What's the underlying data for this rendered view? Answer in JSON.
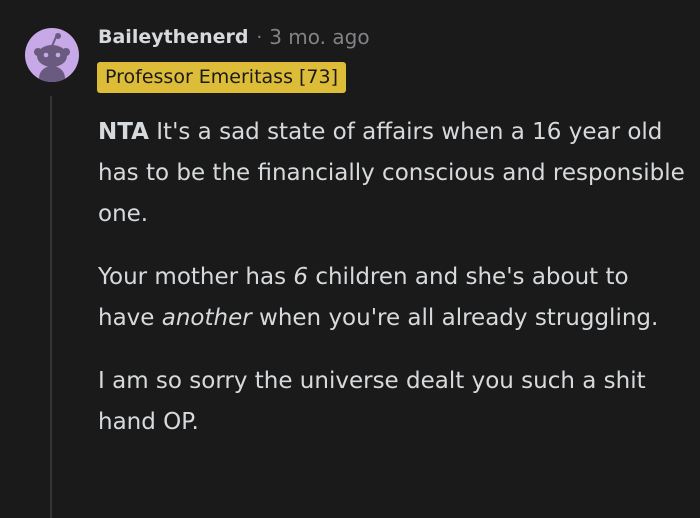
{
  "comment": {
    "username": "Baileythenerd",
    "separator": "·",
    "timestamp": "3 mo. ago",
    "flair": "Professor Emeritass [73]",
    "avatar_icon": "snoo-avatar-icon",
    "p1_bold": "NTA",
    "p1_text": " It's a sad state of affairs when a 16 year old has to be the financially conscious and responsible one.",
    "p2_a": "Your mother has ",
    "p2_number": "6",
    "p2_b": " children and she's about to have ",
    "p2_emph": "another",
    "p2_c": " when you're all already struggling.",
    "p3_text": "I am so sorry the universe dealt you such a shit hand OP."
  },
  "colors": {
    "background": "#1a1a1b",
    "text": "#d7dadc",
    "muted": "#818384",
    "flair_bg": "#ddbd37",
    "avatar_bg": "#c7a9e8"
  }
}
